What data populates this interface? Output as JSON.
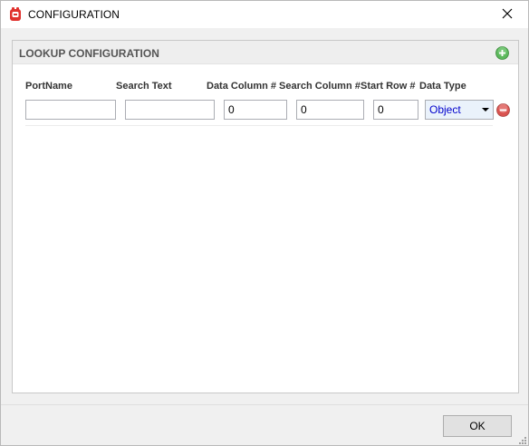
{
  "window": {
    "title": "CONFIGURATION",
    "icon": "app-logo-icon",
    "close_icon": "close-icon"
  },
  "panel": {
    "title": "LOOKUP CONFIGURATION",
    "add_icon": "add-circle-icon",
    "columns": [
      "PortName",
      "Search Text",
      "Data Column #",
      "Search Column #",
      "Start Row #",
      "Data Type"
    ],
    "rows": [
      {
        "port_name": "",
        "search_text": "",
        "data_column": "0",
        "search_column": "0",
        "start_row": "0",
        "data_type": "Object",
        "remove_icon": "remove-circle-icon"
      }
    ]
  },
  "footer": {
    "ok_label": "OK",
    "resize_grip_icon": "resize-grip-icon"
  },
  "colors": {
    "title_bar": "#ffffff",
    "panel_header": "#eeeeee",
    "add_icon": "#5cb85c",
    "remove_icon": "#d9534f",
    "dropdown_text": "#0000cc"
  }
}
